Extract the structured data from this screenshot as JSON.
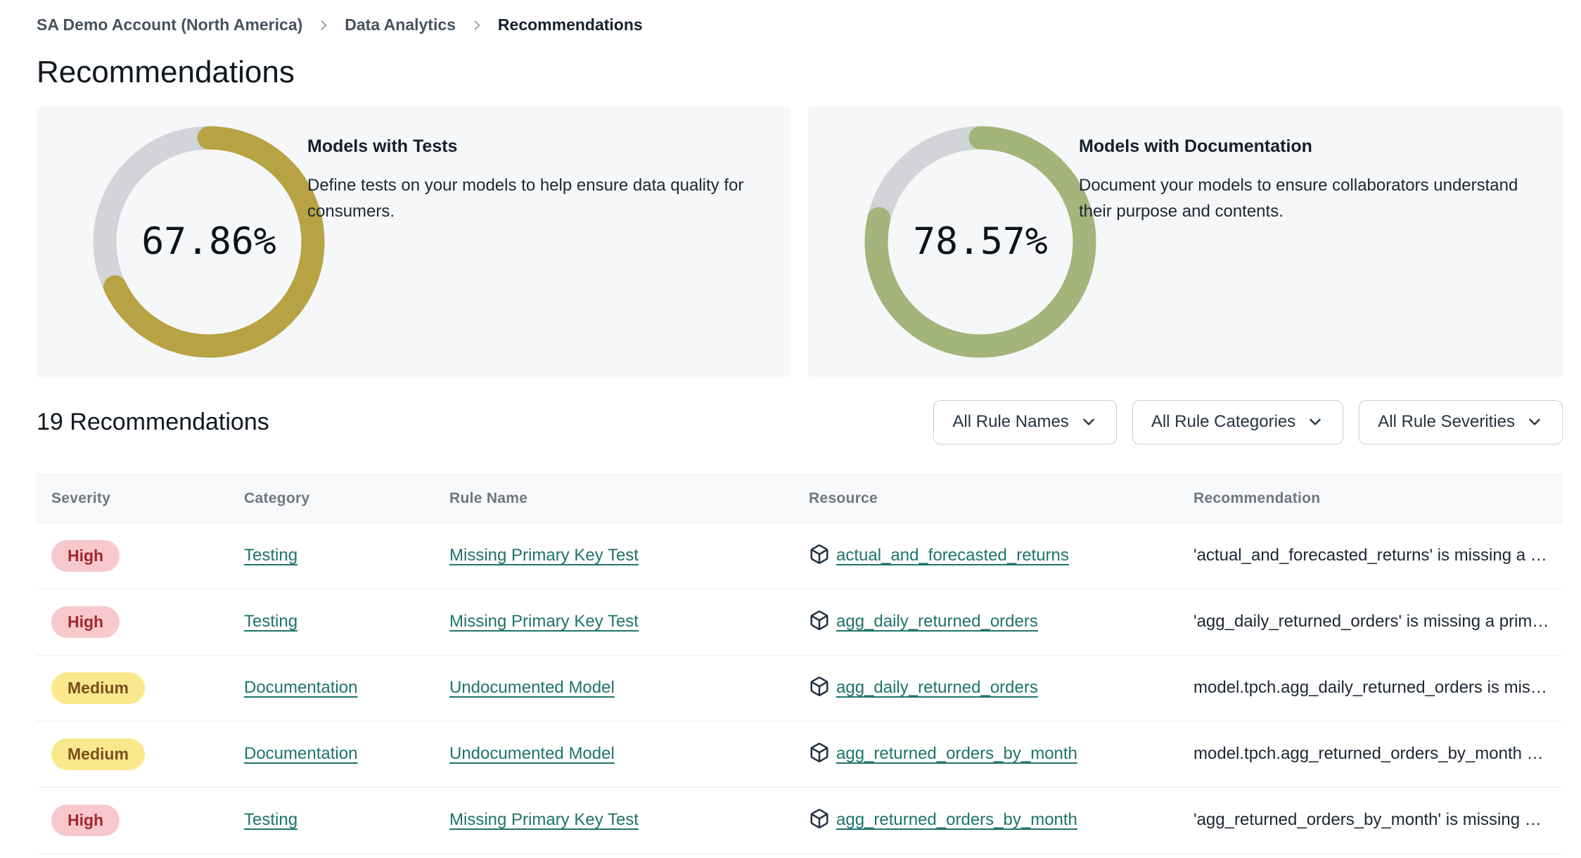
{
  "breadcrumb": {
    "items": [
      {
        "label": "SA Demo Account (North America)"
      },
      {
        "label": "Data Analytics"
      },
      {
        "label": "Recommendations"
      }
    ]
  },
  "page": {
    "title": "Recommendations"
  },
  "summary_cards": [
    {
      "title": "Models with Tests",
      "description": "Define tests on your models to help ensure data quality for consumers.",
      "percent": 67.86,
      "percent_label": "67.86%",
      "color": "#b7a343",
      "track_color": "#d3d4d8"
    },
    {
      "title": "Models with Documentation",
      "description": "Document your models to ensure collaborators understand their purpose and contents.",
      "percent": 78.57,
      "percent_label": "78.57%",
      "color": "#a3b57a",
      "track_color": "#d3d4d8"
    }
  ],
  "list_header": {
    "title": "19 Recommendations",
    "filters": [
      {
        "label": "All Rule Names"
      },
      {
        "label": "All Rule Categories"
      },
      {
        "label": "All Rule Severities"
      }
    ]
  },
  "colors": {
    "link": "#1e746b",
    "severity": {
      "High": {
        "bg": "#f8c9cc",
        "text": "#a32732"
      },
      "Medium": {
        "bg": "#fae98c",
        "text": "#7a4e1f"
      }
    }
  },
  "table": {
    "columns": [
      "Severity",
      "Category",
      "Rule Name",
      "Resource",
      "Recommendation"
    ],
    "rows": [
      {
        "severity": "High",
        "category": "Testing",
        "rule_name": "Missing Primary Key Test",
        "resource": "actual_and_forecasted_returns",
        "recommendation": "'actual_and_forecasted_returns' is missing a …"
      },
      {
        "severity": "High",
        "category": "Testing",
        "rule_name": "Missing Primary Key Test",
        "resource": "agg_daily_returned_orders",
        "recommendation": "'agg_daily_returned_orders' is missing a prim…"
      },
      {
        "severity": "Medium",
        "category": "Documentation",
        "rule_name": "Undocumented Model",
        "resource": "agg_daily_returned_orders",
        "recommendation": "model.tpch.agg_daily_returned_orders is mis…"
      },
      {
        "severity": "Medium",
        "category": "Documentation",
        "rule_name": "Undocumented Model",
        "resource": "agg_returned_orders_by_month",
        "recommendation": "model.tpch.agg_returned_orders_by_month …"
      },
      {
        "severity": "High",
        "category": "Testing",
        "rule_name": "Missing Primary Key Test",
        "resource": "agg_returned_orders_by_month",
        "recommendation": "'agg_returned_orders_by_month' is missing …"
      }
    ]
  }
}
